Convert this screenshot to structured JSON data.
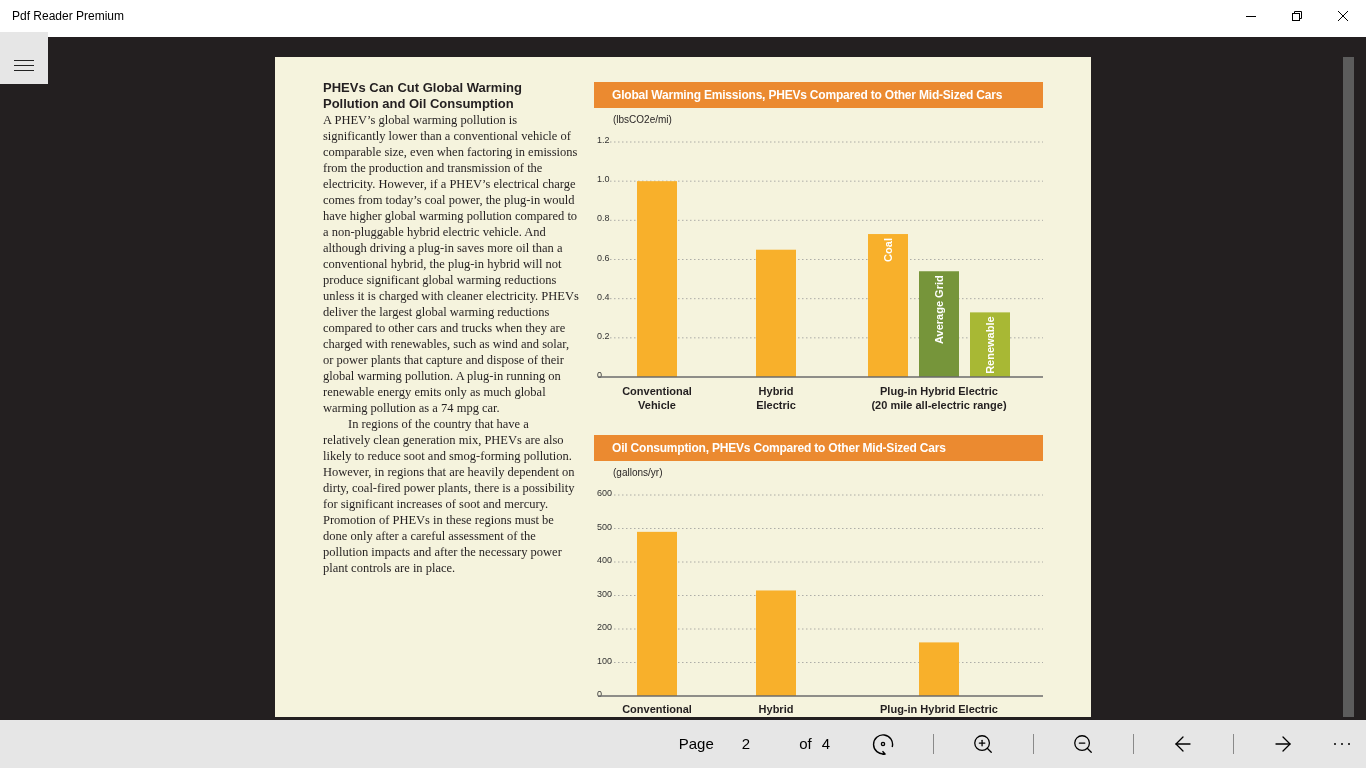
{
  "window": {
    "title": "Pdf Reader Premium"
  },
  "document": {
    "article": {
      "heading": "PHEVs Can Cut Global Warming Pollution and Oil Consumption",
      "paragraphs": [
        "A PHEV’s global warming pollution is significantly lower than a conventional vehicle of comparable size, even when factoring in emissions from the production and transmission of the electricity. However, if a PHEV’s electrical charge comes from today’s coal power, the plug-in would have higher global warming pollution compared to a non-pluggable hybrid electric vehicle. And although driving a plug-in saves more oil than a conventional hybrid, the plug-in hybrid will not produce significant global warming reductions unless it is charged with cleaner electricity. PHEVs deliver the largest global warming reductions compared to other cars and trucks when they are charged with renewables, such as wind and solar, or power plants that capture and dispose of their global warming pollution. A plug-in running on renewable energy emits only as much global warming pollution as a 74 mpg car.",
        "In regions of the country that have a relatively clean generation mix, PHEVs are also likely to reduce soot and smog-forming pollution. However, in regions that are heavily dependent on dirty, coal-fired power plants, there is a possibility for significant increases of soot and mercury. Promotion of PHEVs in these regions must be done only after a careful assessment of the pollution impacts and after the necessary power plant controls are in place."
      ]
    },
    "charts": [
      {
        "chart_data": {
          "type": "bar",
          "title": "Global Warming Emissions, PHEVs Compared to Other Mid-Sized Cars",
          "ylabel": "(lbsCO2e/mi)",
          "categories": [
            "Conventional\nVehicle",
            "Hybrid\nElectric",
            "Plug-in Hybrid Electric\n(20 mile all-electric range)"
          ],
          "series": [
            {
              "color": "#f8b02b",
              "values": [
                1.0,
                0.65,
                null
              ]
            },
            {
              "name": "Coal",
              "color": "#f8b02b",
              "values": [
                null,
                null,
                0.73
              ]
            },
            {
              "name": "Average Grid",
              "color": "#76953a",
              "values": [
                null,
                null,
                0.54
              ]
            },
            {
              "name": "Renewable",
              "color": "#a8b834",
              "values": [
                null,
                null,
                0.33
              ]
            }
          ],
          "ylim": [
            0,
            1.2
          ],
          "yticks": [
            {
              "value": 0,
              "label": "0"
            },
            {
              "value": 0.2,
              "label": "0.2"
            },
            {
              "value": 0.4,
              "label": "0.4"
            },
            {
              "value": 0.6,
              "label": "0.6"
            },
            {
              "value": 0.8,
              "label": "0.8"
            },
            {
              "value": 1.0,
              "label": "1.0"
            },
            {
              "value": 1.2,
              "label": "1.2"
            }
          ],
          "grid": true
        }
      },
      {
        "chart_data": {
          "type": "bar",
          "title": "Oil Consumption, PHEVs Compared to Other Mid-Sized Cars",
          "ylabel": "(gallons/yr)",
          "categories": [
            "Conventional",
            "Hybrid",
            "Plug-in Hybrid Electric"
          ],
          "values": [
            490,
            315,
            160
          ],
          "color": "#f8b02b",
          "ylim": [
            0,
            600
          ],
          "yticks": [
            0,
            100,
            200,
            300,
            400,
            500,
            600
          ],
          "grid": true
        }
      }
    ]
  },
  "toolbar": {
    "page_label": "Page",
    "page_number": "2",
    "of_label": "of",
    "page_count": "4"
  }
}
